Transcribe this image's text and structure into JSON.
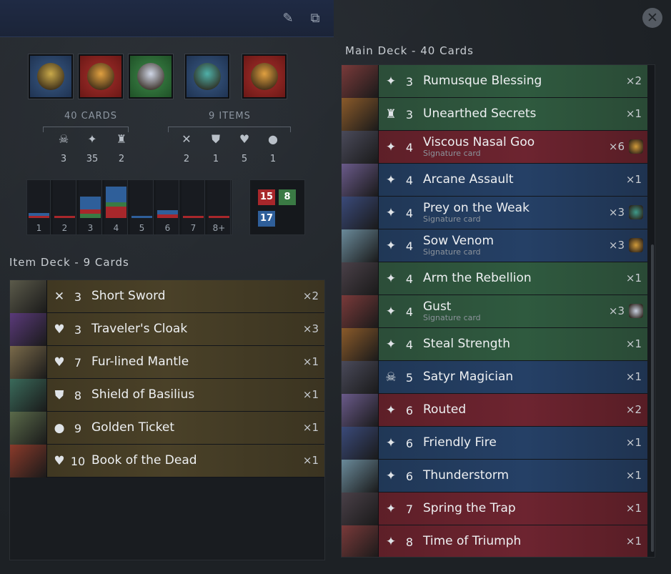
{
  "left": {
    "heroes": [
      {
        "color": "blue",
        "name": "hero-1"
      },
      {
        "color": "red",
        "name": "hero-2"
      },
      {
        "color": "green",
        "name": "hero-3"
      },
      {
        "color": "blue",
        "name": "hero-4"
      },
      {
        "color": "red",
        "name": "hero-5"
      }
    ],
    "cards_label": "40 CARDS",
    "items_label": "9 ITEMS",
    "card_stats": [
      {
        "icon": "creep-icon",
        "glyph": "☠",
        "value": "3"
      },
      {
        "icon": "spell-icon",
        "glyph": "✦",
        "value": "35"
      },
      {
        "icon": "improvement-icon",
        "glyph": "♜",
        "value": "2"
      }
    ],
    "item_stats": [
      {
        "icon": "weapon-icon",
        "glyph": "✕",
        "value": "2"
      },
      {
        "icon": "armor-icon",
        "glyph": "⛊",
        "value": "1"
      },
      {
        "icon": "health-icon",
        "glyph": "♥",
        "value": "5"
      },
      {
        "icon": "consumable-icon",
        "glyph": "●",
        "value": "1"
      }
    ],
    "mana_curve": {
      "labels": [
        "1",
        "2",
        "3",
        "4",
        "5",
        "6",
        "7",
        "8+"
      ],
      "colors": {
        "blue": "#2f5f9a",
        "red": "#a8272b",
        "green": "#3a7a44"
      }
    },
    "color_counts": {
      "red": "15",
      "green": "8",
      "blue": "17"
    },
    "item_deck_title": "Item Deck - 9 Cards",
    "items": [
      {
        "type_glyph": "✕",
        "type_icon": "weapon-icon",
        "cost": "3",
        "name": "Short Sword",
        "count": "×2"
      },
      {
        "type_glyph": "♥",
        "type_icon": "health-icon",
        "cost": "3",
        "name": "Traveler's Cloak",
        "count": "×3"
      },
      {
        "type_glyph": "♥",
        "type_icon": "health-icon",
        "cost": "7",
        "name": "Fur-lined Mantle",
        "count": "×1"
      },
      {
        "type_glyph": "⛊",
        "type_icon": "armor-icon",
        "cost": "8",
        "name": "Shield of Basilius",
        "count": "×1"
      },
      {
        "type_glyph": "●",
        "type_icon": "consumable-icon",
        "cost": "9",
        "name": "Golden Ticket",
        "count": "×1"
      },
      {
        "type_glyph": "♥",
        "type_icon": "health-icon",
        "cost": "10",
        "name": "Book of the Dead",
        "count": "×1"
      }
    ]
  },
  "right": {
    "close_glyph": "✕",
    "main_deck_title": "Main Deck - 40 Cards",
    "cards": [
      {
        "color": "green",
        "type_glyph": "✦",
        "type_icon": "spell-icon",
        "cost": "3",
        "name": "Rumusque Blessing",
        "sub": "",
        "count": "×2",
        "sig": ""
      },
      {
        "color": "green",
        "type_glyph": "♜",
        "type_icon": "improvement-icon",
        "cost": "3",
        "name": "Unearthed Secrets",
        "sub": "",
        "count": "×1",
        "sig": ""
      },
      {
        "color": "red",
        "type_glyph": "✦",
        "type_icon": "spell-icon",
        "cost": "4",
        "name": "Viscous Nasal Goo",
        "sub": "Signature card",
        "count": "×6",
        "sig": "gold"
      },
      {
        "color": "blue",
        "type_glyph": "✦",
        "type_icon": "spell-icon",
        "cost": "4",
        "name": "Arcane Assault",
        "sub": "",
        "count": "×1",
        "sig": ""
      },
      {
        "color": "blue",
        "type_glyph": "✦",
        "type_icon": "spell-icon",
        "cost": "4",
        "name": "Prey on the Weak",
        "sub": "Signature card",
        "count": "×3",
        "sig": "teal"
      },
      {
        "color": "blue",
        "type_glyph": "✦",
        "type_icon": "spell-icon",
        "cost": "4",
        "name": "Sow Venom",
        "sub": "Signature card",
        "count": "×3",
        "sig": "gold"
      },
      {
        "color": "green",
        "type_glyph": "✦",
        "type_icon": "spell-icon",
        "cost": "4",
        "name": "Arm the Rebellion",
        "sub": "",
        "count": "×1",
        "sig": ""
      },
      {
        "color": "green",
        "type_glyph": "✦",
        "type_icon": "spell-icon",
        "cost": "4",
        "name": "Gust",
        "sub": "Signature card",
        "count": "×3",
        "sig": "pale"
      },
      {
        "color": "green",
        "type_glyph": "✦",
        "type_icon": "spell-icon",
        "cost": "4",
        "name": "Steal Strength",
        "sub": "",
        "count": "×1",
        "sig": ""
      },
      {
        "color": "blue",
        "type_glyph": "☠",
        "type_icon": "creep-icon",
        "cost": "5",
        "name": "Satyr Magician",
        "sub": "",
        "count": "×1",
        "sig": ""
      },
      {
        "color": "red",
        "type_glyph": "✦",
        "type_icon": "spell-icon",
        "cost": "6",
        "name": "Routed",
        "sub": "",
        "count": "×2",
        "sig": ""
      },
      {
        "color": "blue",
        "type_glyph": "✦",
        "type_icon": "spell-icon",
        "cost": "6",
        "name": "Friendly Fire",
        "sub": "",
        "count": "×1",
        "sig": ""
      },
      {
        "color": "blue",
        "type_glyph": "✦",
        "type_icon": "spell-icon",
        "cost": "6",
        "name": "Thunderstorm",
        "sub": "",
        "count": "×1",
        "sig": ""
      },
      {
        "color": "red",
        "type_glyph": "✦",
        "type_icon": "spell-icon",
        "cost": "7",
        "name": "Spring the Trap",
        "sub": "",
        "count": "×1",
        "sig": ""
      },
      {
        "color": "red",
        "type_glyph": "✦",
        "type_icon": "spell-icon",
        "cost": "8",
        "name": "Time of Triumph",
        "sub": "",
        "count": "×1",
        "sig": ""
      }
    ]
  }
}
